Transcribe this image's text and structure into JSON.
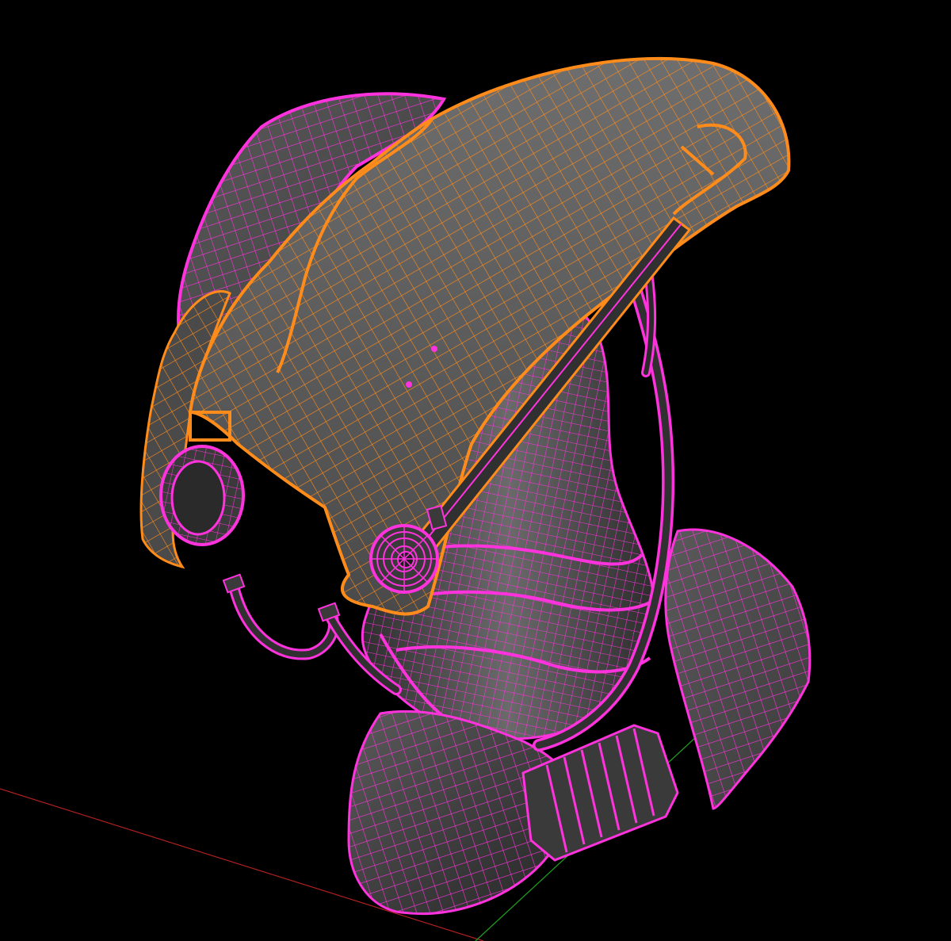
{
  "viewport": {
    "background": "#000000",
    "shaded_surface_color": "#3c3c3c",
    "selected_wire_color": "#ff8c1a",
    "wire_color": "#ff33dd",
    "axis_x_color": "#b02020",
    "axis_y_color": "#1fa51f"
  },
  "model": {
    "object_icon": "wireframe-helmet-model",
    "selected_part": "helmet-crest"
  }
}
